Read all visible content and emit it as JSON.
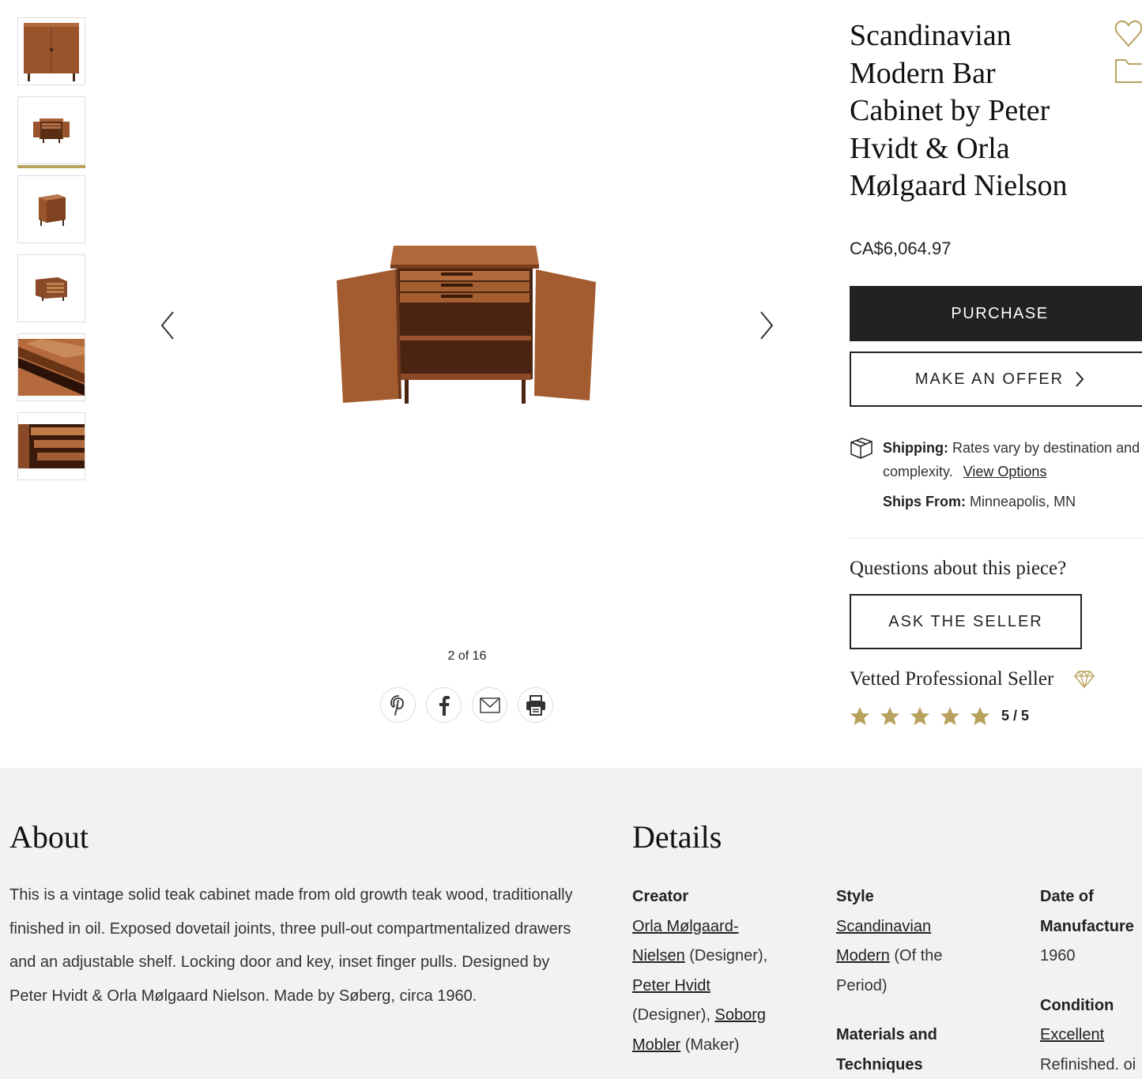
{
  "product": {
    "title": "Scandinavian Modern Bar Cabinet by Peter Hvidt & Orla Mølgaard Nielson",
    "price": "CA$6,064.97"
  },
  "gallery": {
    "counter": "2 of 16",
    "active_index": 2,
    "thumbnail_count": 6
  },
  "icons": {
    "favorite": "heart-icon",
    "folder": "folder-icon",
    "prev": "chevron-left-icon",
    "next": "chevron-right-icon",
    "share": [
      "pinterest-icon",
      "facebook-icon",
      "email-icon",
      "print-icon"
    ],
    "shipping": "package-icon",
    "vetted": "diamond-icon"
  },
  "actions": {
    "purchase": "PURCHASE",
    "offer": "MAKE AN OFFER",
    "ask": "ASK THE SELLER"
  },
  "shipping": {
    "label": "Shipping:",
    "text": "Rates vary by destination and complexity.",
    "link": "View Options",
    "from_label": "Ships From:",
    "from_value": "Minneapolis, MN"
  },
  "seller": {
    "questions": "Questions about this piece?",
    "vetted": "Vetted Professional Seller",
    "rating": "5 / 5",
    "stars": 5
  },
  "about": {
    "heading": "About",
    "body": "This is a vintage solid teak cabinet made from old growth teak wood, traditionally finished in oil. Exposed dovetail joints, three pull-out compartmentalized drawers and an adjustable shelf. Locking door and key, inset finger pulls. Designed by Peter Hvidt & Orla Mølgaard Nielson. Made by Søberg, circa 1960."
  },
  "details": {
    "heading": "Details",
    "creator_label": "Creator",
    "creator1_link": "Orla Mølgaard-Nielsen",
    "creator1_role": "(Designer),",
    "creator2_link": "Peter Hvidt",
    "creator2_role": "(Designer),",
    "creator3_link": "Soborg Mobler",
    "creator3_role": "(Maker)",
    "style_label": "Style",
    "style_link": "Scandinavian Modern",
    "style_note": "(Of the Period)",
    "materials_label": "Materials and Techniques",
    "date_label": "Date of Manufacture",
    "date_value": "1960",
    "condition_label": "Condition",
    "condition_link": "Excellent",
    "condition_note": "Refinished. oi"
  },
  "colors": {
    "accent": "#b8a25e",
    "dark": "#222222",
    "teak": "#8a4a28"
  }
}
